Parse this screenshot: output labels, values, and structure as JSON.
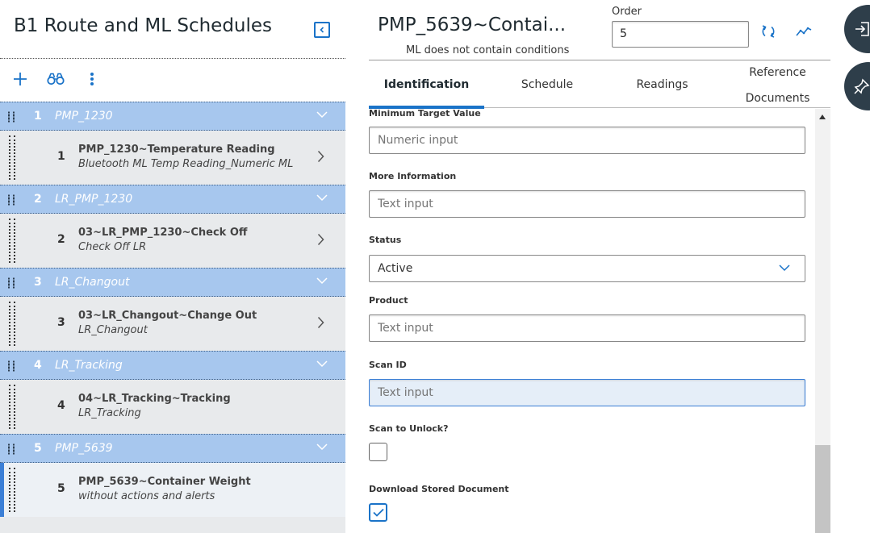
{
  "app": {
    "title": "B1 Route and ML Schedules"
  },
  "toolbar": {
    "add_icon": "plus-icon",
    "find_icon": "binoculars-icon",
    "more_icon": "kebab-icon"
  },
  "groups": [
    {
      "num": "1",
      "name": "PMP_1230",
      "item": {
        "num": "1",
        "title": "PMP_1230~Temperature Reading",
        "subtitle": "Bluetooth ML Temp Reading_Numeric ML"
      }
    },
    {
      "num": "2",
      "name": "LR_PMP_1230",
      "item": {
        "num": "2",
        "title": "03~LR_PMP_1230~Check Off",
        "subtitle": "Check Off LR"
      }
    },
    {
      "num": "3",
      "name": "LR_Changout",
      "item": {
        "num": "3",
        "title": "03~LR_Changout~Change Out",
        "subtitle": "LR_Changout"
      }
    },
    {
      "num": "4",
      "name": "LR_Tracking",
      "item": {
        "num": "4",
        "title": "04~LR_Tracking~Tracking",
        "subtitle": "LR_Tracking"
      }
    },
    {
      "num": "5",
      "name": "PMP_5639",
      "item": {
        "num": "5",
        "title": "PMP_5639~Container Weight",
        "subtitle": "without actions and alerts"
      }
    }
  ],
  "record": {
    "title": "PMP_5639~Contai...",
    "subtitle": "ML does not contain conditions",
    "order_label": "Order",
    "order_value": "5"
  },
  "tabs": [
    {
      "label": "Identification"
    },
    {
      "label": "Schedule"
    },
    {
      "label": "Readings"
    },
    {
      "label_line1": "Reference",
      "label_line2": "Documents"
    }
  ],
  "form": {
    "min_target_label": "Minimum Target Value",
    "min_target_placeholder": "Numeric input",
    "more_info_label": "More Information",
    "more_info_placeholder": "Text input",
    "status_label": "Status",
    "status_value": "Active",
    "product_label": "Product",
    "product_placeholder": "Text input",
    "scan_id_label": "Scan ID",
    "scan_id_placeholder": "Text input",
    "scan_unlock_label": "Scan to Unlock?",
    "download_label": "Download Stored Document"
  },
  "colors": {
    "accent": "#1a73c8",
    "group_header": "#a7c7ee",
    "rail": "#2e3e4a"
  }
}
